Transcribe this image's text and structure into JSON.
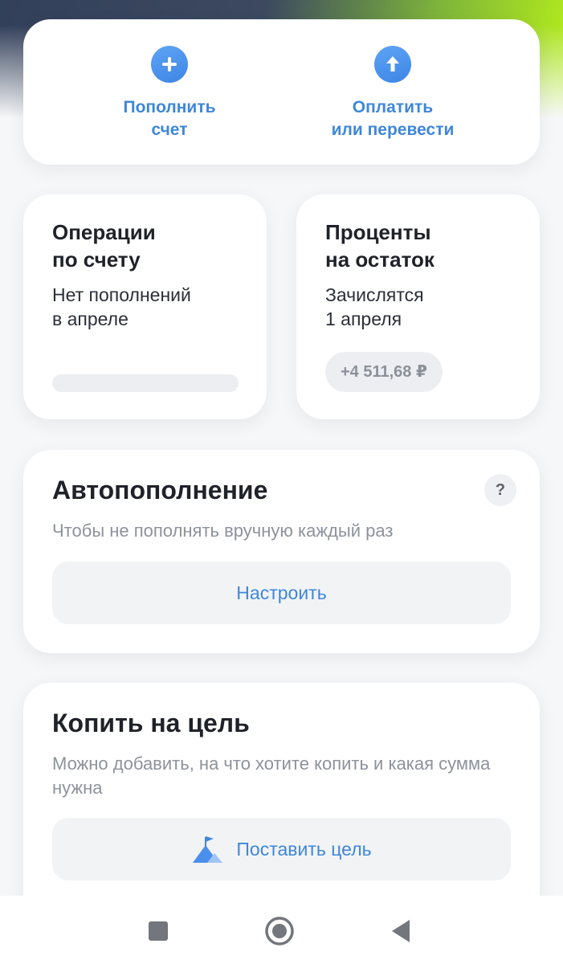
{
  "actions": {
    "topup_label": "Пополнить\nсчет",
    "pay_label": "Оплатить\nили перевести"
  },
  "operations": {
    "title": "Операции\nпо счету",
    "subtitle": "Нет пополнений\nв апреле"
  },
  "interest": {
    "title": "Проценты\nна остаток",
    "subtitle": "Зачислятся\n1 апреля",
    "amount": "+4 511,68 ₽"
  },
  "autotopup": {
    "title": "Автопополнение",
    "description": "Чтобы не пополнять вручную каждый раз",
    "help_label": "?",
    "button_label": "Настроить"
  },
  "goal": {
    "title": "Копить на цель",
    "description": "Можно добавить, на что хотите копить и какая сумма нужна",
    "button_label": "Поставить цель"
  },
  "colors": {
    "accent": "#3f87d9",
    "icon_blue": "#4a8fec",
    "title_text": "#1f2229",
    "muted_text": "#8d929b"
  },
  "icons": {
    "topup": "plus-circle-icon",
    "pay": "arrow-up-circle-icon",
    "goal": "mountain-flag-icon",
    "nav_recents": "square-icon",
    "nav_home": "circle-icon",
    "nav_back": "triangle-back-icon"
  }
}
